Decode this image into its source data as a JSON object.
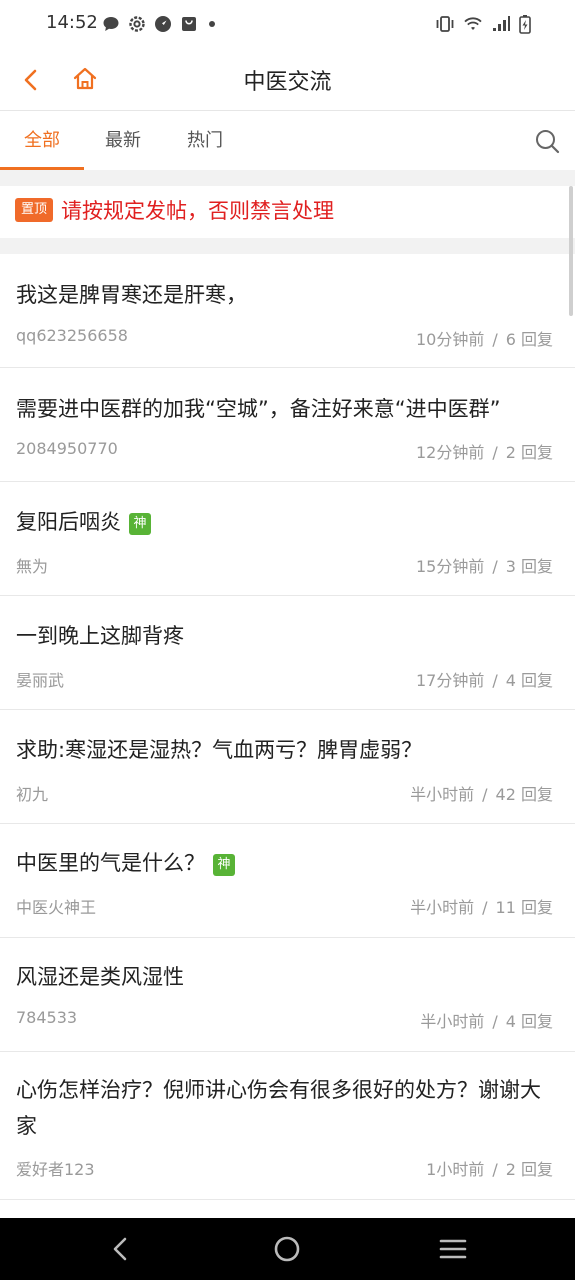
{
  "status_bar": {
    "time": "14:52",
    "left_icons": [
      "message-icon",
      "gear-icon",
      "compass-icon",
      "shopping-bag-icon",
      "dot-icon"
    ],
    "right_icons": [
      "vibrate-icon",
      "wifi-icon",
      "signal-icon",
      "battery-charging-icon"
    ]
  },
  "header": {
    "title": "中医交流",
    "accent_color": "#f07020"
  },
  "tabs": [
    {
      "label": "全部",
      "active": true
    },
    {
      "label": "最新",
      "active": false
    },
    {
      "label": "热门",
      "active": false
    }
  ],
  "pinned": {
    "badge": "置顶",
    "text": "请按规定发帖，否则禁言处理"
  },
  "posts": [
    {
      "title": "我这是脾胃寒还是肝寒，",
      "badge": "",
      "author": "qq623256658",
      "time": "10分钟前",
      "separator": "/",
      "replies": "6 回复"
    },
    {
      "title": "需要进中医群的加我“空城”，备注好来意“进中医群”",
      "badge": "",
      "author": "2084950770",
      "time": "12分钟前",
      "separator": "/",
      "replies": "2 回复"
    },
    {
      "title": "复阳后咽炎",
      "badge": "神",
      "author": "無为",
      "time": "15分钟前",
      "separator": "/",
      "replies": "3 回复"
    },
    {
      "title": "一到晚上这脚背疼",
      "badge": "",
      "author": "晏丽武",
      "time": "17分钟前",
      "separator": "/",
      "replies": "4 回复"
    },
    {
      "title": "求助:寒湿还是湿热？气血两亏？脾胃虚弱？",
      "badge": "",
      "author": "初九",
      "time": "半小时前",
      "separator": "/",
      "replies": "42 回复"
    },
    {
      "title": "中医里的气是什么？",
      "badge": "神",
      "author": "中医火神王",
      "time": "半小时前",
      "separator": "/",
      "replies": "11 回复"
    },
    {
      "title": "风湿还是类风湿性",
      "badge": "",
      "author": "784533",
      "time": "半小时前",
      "separator": "/",
      "replies": "4 回复"
    },
    {
      "title": "心伤怎样治疗？倪师讲心伤会有很多很好的处方？谢谢大家",
      "badge": "",
      "author": "爱好者123",
      "time": "1小时前",
      "separator": "/",
      "replies": "2 回复"
    }
  ],
  "nav_bar": {
    "icons": [
      "back-triangle-icon",
      "home-circle-icon",
      "menu-lines-icon"
    ]
  }
}
